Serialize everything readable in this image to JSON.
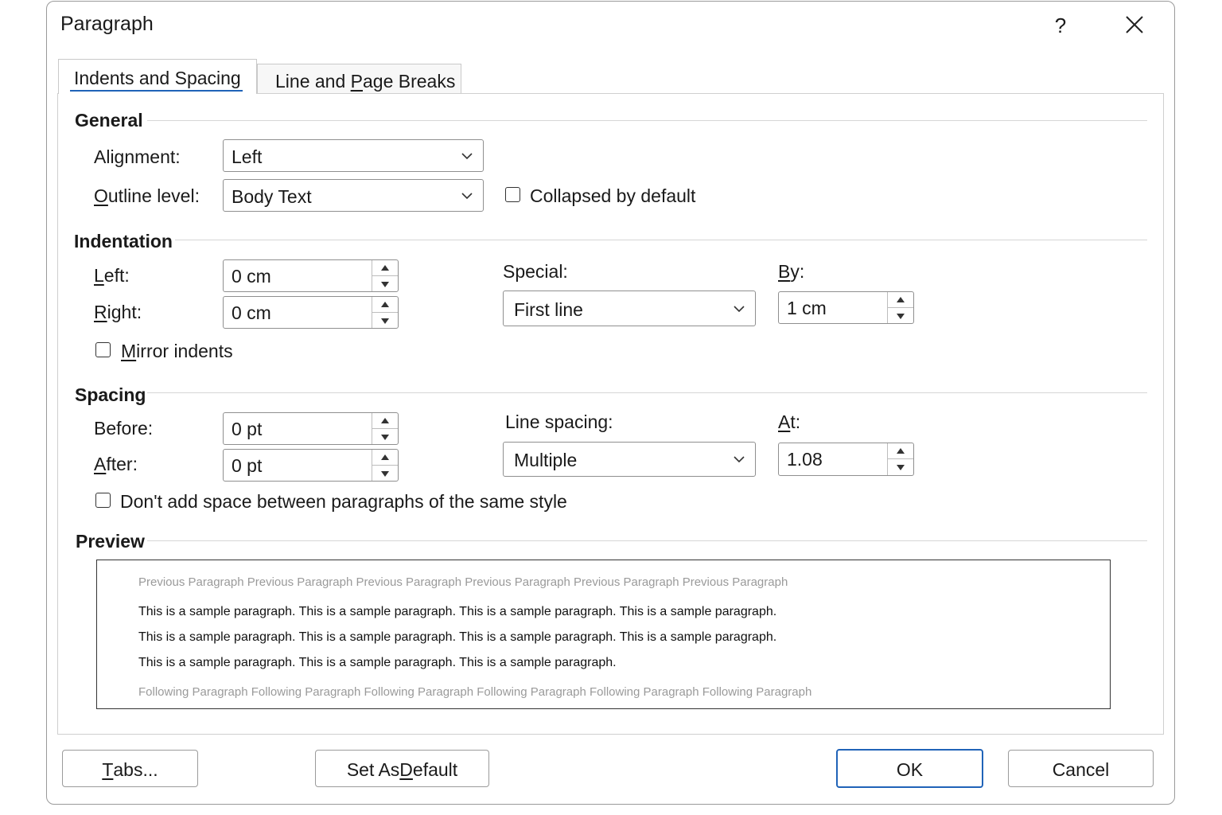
{
  "dialog": {
    "title": "Paragraph",
    "help_label": "?"
  },
  "tabs": {
    "indents_spacing": "Indents and Spacing",
    "line_page_breaks_pre": "Line and ",
    "line_page_breaks_key": "P",
    "line_page_breaks_post": "age Breaks"
  },
  "general": {
    "heading": "General",
    "alignment_label": "Alignment:",
    "alignment_value": "Left",
    "outline_key": "O",
    "outline_rest": "utline level:",
    "outline_value": "Body Text",
    "collapsed_label": "Collapsed by default"
  },
  "indentation": {
    "heading": "Indentation",
    "left_key": "L",
    "left_rest": "eft:",
    "left_value": "0 cm",
    "right_key": "R",
    "right_rest": "ight:",
    "right_value": "0 cm",
    "special_label": "Special:",
    "special_value": "First line",
    "by_key": "B",
    "by_rest": "y:",
    "by_value": "1 cm",
    "mirror_key": "M",
    "mirror_rest": "irror indents"
  },
  "spacing": {
    "heading": "Spacing",
    "before_label": "Before:",
    "before_value": "0 pt",
    "after_key": "A",
    "after_rest": "fter:",
    "after_value": "0 pt",
    "line_spacing_label": "Line spacing:",
    "line_spacing_value": "Multiple",
    "at_key": "A",
    "at_rest": "t:",
    "at_value": "1.08",
    "dont_add_label": "Don't add space between paragraphs of the same style"
  },
  "preview": {
    "heading": "Preview",
    "previous": "Previous Paragraph Previous Paragraph Previous Paragraph  Previous Paragraph  Previous Paragraph Previous Paragraph",
    "sample_lines": [
      "This is a sample paragraph. This is a sample paragraph. This is a sample paragraph. This is a sample paragraph.",
      "This is a sample paragraph. This is a sample paragraph. This is a sample paragraph. This is a sample paragraph.",
      "This is a sample paragraph. This is a sample paragraph. This is a sample paragraph."
    ],
    "following": "Following Paragraph Following Paragraph Following Paragraph Following Paragraph Following Paragraph Following Paragraph"
  },
  "buttons": {
    "tabs_key": "T",
    "tabs_rest": "abs...",
    "set_default_pre": "Set As ",
    "set_default_key": "D",
    "set_default_post": "efault",
    "ok": "OK",
    "cancel": "Cancel"
  },
  "colors": {
    "accent": "#2063b8",
    "preview_gray": "#9a9a9a"
  },
  "icons": {
    "close": "close-icon",
    "dropdown": "chevron-down-icon",
    "spin_up": "spin-up-icon",
    "spin_down": "spin-down-icon"
  }
}
